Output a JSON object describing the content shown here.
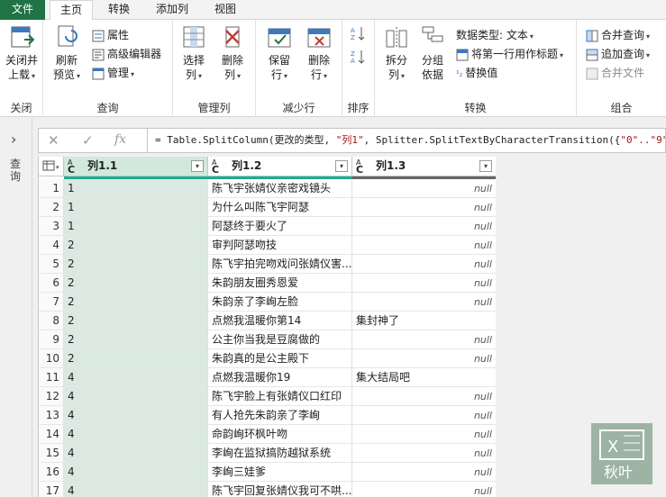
{
  "tabs": [
    "文件",
    "主页",
    "转换",
    "添加列",
    "视图"
  ],
  "ribbon": {
    "close": {
      "btn1": "关闭并",
      "btn1b": "上载",
      "label": "关闭"
    },
    "query": {
      "refresh": "刷新",
      "refresh_b": "预览",
      "props": "属性",
      "adv": "高级编辑器",
      "manage": "管理",
      "label": "查询"
    },
    "manage_cols": {
      "select": "选择",
      "select_b": "列",
      "remove": "删除",
      "remove_b": "列",
      "label": "管理列"
    },
    "reduce_rows": {
      "keep": "保留",
      "keep_b": "行",
      "remove": "删除",
      "remove_b": "行",
      "label": "减少行"
    },
    "sort": {
      "label": "排序"
    },
    "transform": {
      "split": "拆分",
      "split_b": "列",
      "group": "分组",
      "group_b": "依据",
      "dtype": "数据类型: 文本",
      "first_row": "将第一行用作标题",
      "replace": "替换值",
      "label": "转换"
    },
    "combine": {
      "merge": "合并查询",
      "append": "追加查询",
      "files": "合并文件",
      "label": "组合"
    }
  },
  "sidebar": {
    "label": "查询"
  },
  "formula": {
    "prefix": "= Table.SplitColumn(更改的类型, ",
    "str1": "\"列1\"",
    "mid": ", Splitter.SplitTextByCharacterTransition({",
    "str2": "\"0\"..\"9\"",
    "tail": ""
  },
  "columns": [
    {
      "type": "ABC",
      "name": "列1.1"
    },
    {
      "type": "ABC",
      "name": "列1.2"
    },
    {
      "type": "ABC",
      "name": "列1.3"
    }
  ],
  "null_text": "null",
  "rows": [
    {
      "n": "1",
      "a": "1",
      "b": "陈飞宇张婧仪亲密戏镜头",
      "c": null
    },
    {
      "n": "2",
      "a": "1",
      "b": "为什么叫陈飞宇阿瑟",
      "c": null
    },
    {
      "n": "3",
      "a": "1",
      "b": "阿瑟终于要火了",
      "c": null
    },
    {
      "n": "4",
      "a": "2",
      "b": "审判阿瑟吻技",
      "c": null
    },
    {
      "n": "5",
      "a": "2",
      "b": "陈飞宇拍完吻戏问张婧仪害...",
      "c": null
    },
    {
      "n": "6",
      "a": "2",
      "b": "朱韵朋友圈秀恩爱",
      "c": null
    },
    {
      "n": "7",
      "a": "2",
      "b": "朱韵亲了李峋左脸",
      "c": null
    },
    {
      "n": "8",
      "a": "2",
      "b": "点燃我温暖你第14",
      "c": "集封神了"
    },
    {
      "n": "9",
      "a": "2",
      "b": "公主你当我是豆腐做的",
      "c": null
    },
    {
      "n": "10",
      "a": "2",
      "b": "朱韵真的是公主殿下",
      "c": null
    },
    {
      "n": "11",
      "a": "4",
      "b": "点燃我温暖你19",
      "c": "集大结局吧"
    },
    {
      "n": "12",
      "a": "4",
      "b": "陈飞宇脸上有张婧仪口红印",
      "c": null
    },
    {
      "n": "13",
      "a": "4",
      "b": "有人抢先朱韵亲了李峋",
      "c": null
    },
    {
      "n": "14",
      "a": "4",
      "b": "命韵峋环枫叶吻",
      "c": null
    },
    {
      "n": "15",
      "a": "4",
      "b": "李峋在监狱搞防越狱系统",
      "c": null
    },
    {
      "n": "16",
      "a": "4",
      "b": "李峋三娃爹",
      "c": null
    },
    {
      "n": "17",
      "a": "4",
      "b": "陈飞宇回复张婧仪我可不哄...",
      "c": null
    }
  ],
  "colors": {
    "accent": "#217346",
    "quality_green": "#1aaf8f",
    "quality_grey": "#666666"
  }
}
